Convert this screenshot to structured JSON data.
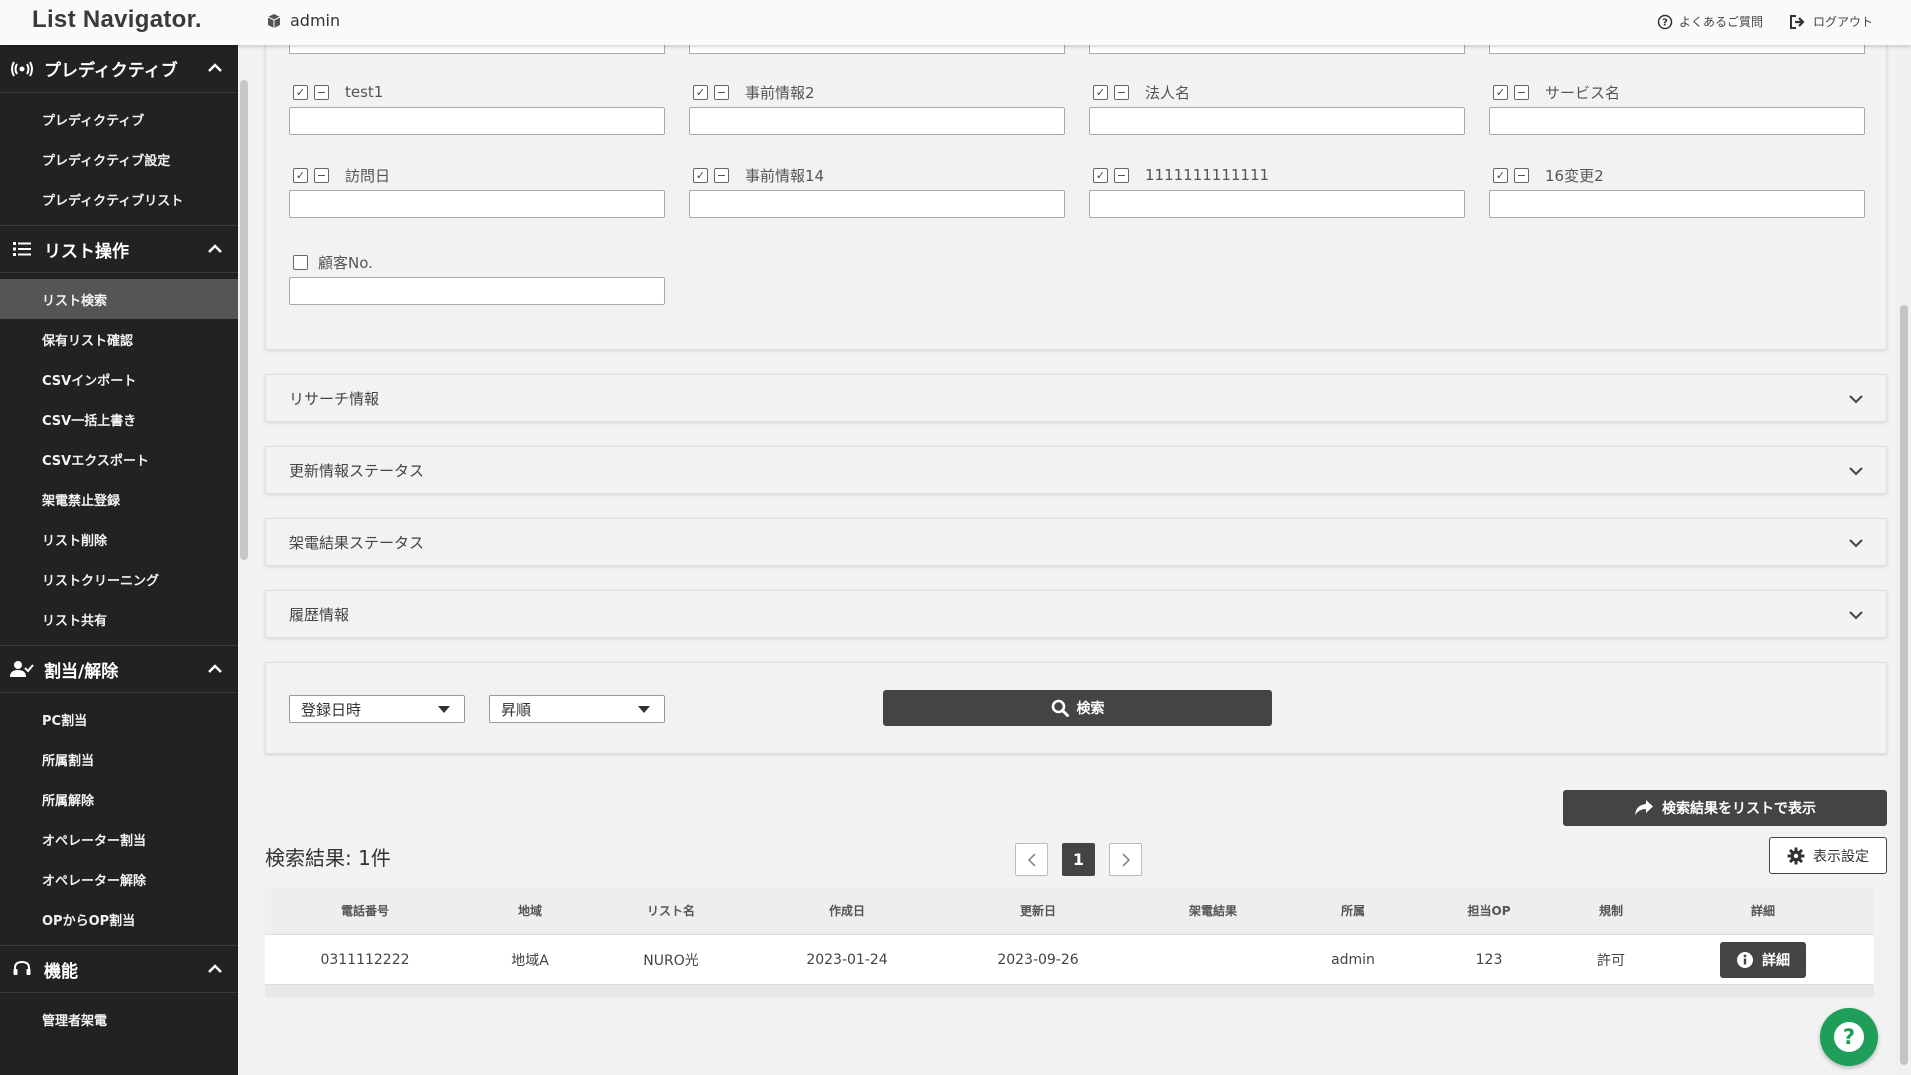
{
  "header": {
    "logo": "List Navigator.",
    "user": "admin",
    "faq": "よくあるご質問",
    "logout": "ログアウト"
  },
  "sidebar": {
    "sections": [
      {
        "title": "プレディクティブ",
        "icon": "broadcast-icon",
        "items": [
          "プレディクティブ",
          "プレディクティブ設定",
          "プレディクティブリスト"
        ]
      },
      {
        "title": "リスト操作",
        "icon": "list-icon",
        "items": [
          "リスト検索",
          "保有リスト確認",
          "CSVインポート",
          "CSV一括上書き",
          "CSVエクスポート",
          "架電禁止登録",
          "リスト削除",
          "リストクリーニング",
          "リスト共有"
        ]
      },
      {
        "title": "割当/解除",
        "icon": "user-check-icon",
        "items": [
          "PC割当",
          "所属割当",
          "所属解除",
          "オペレーター割当",
          "オペレーター解除",
          "OPからOP割当"
        ]
      },
      {
        "title": "機能",
        "icon": "headset-icon",
        "items": [
          "管理者架電"
        ]
      }
    ],
    "active_item": "リスト検索"
  },
  "fields": {
    "row1": [
      "test1",
      "事前情報2",
      "法人名",
      "サービス名"
    ],
    "row2": [
      "訪問日",
      "事前情報14",
      "1111111111111",
      "16変更2"
    ],
    "row3": [
      "顧客No."
    ]
  },
  "accordions": [
    "リサーチ情報",
    "更新情報ステータス",
    "架電結果ステータス",
    "履歴情報"
  ],
  "search": {
    "sort_field": "登録日時",
    "sort_order": "昇順",
    "button": "検索"
  },
  "results": {
    "list_button": "検索結果をリストで表示",
    "count_label": "検索結果: 1件",
    "current_page": "1",
    "display_settings": "表示設定",
    "columns": [
      "電話番号",
      "地域",
      "リスト名",
      "作成日",
      "更新日",
      "架電結果",
      "所属",
      "担当OP",
      "規制",
      "詳細"
    ],
    "rows": [
      [
        "0311112222",
        "地域A",
        "NURO光",
        "2023-01-24",
        "2023-09-26",
        "",
        "admin",
        "123",
        "許可",
        "詳細"
      ]
    ]
  },
  "colors": {
    "sidebar_bg": "#222222",
    "active_item_bg": "#555555",
    "dark_button": "#444444",
    "help_fab": "#1f9e5a"
  }
}
